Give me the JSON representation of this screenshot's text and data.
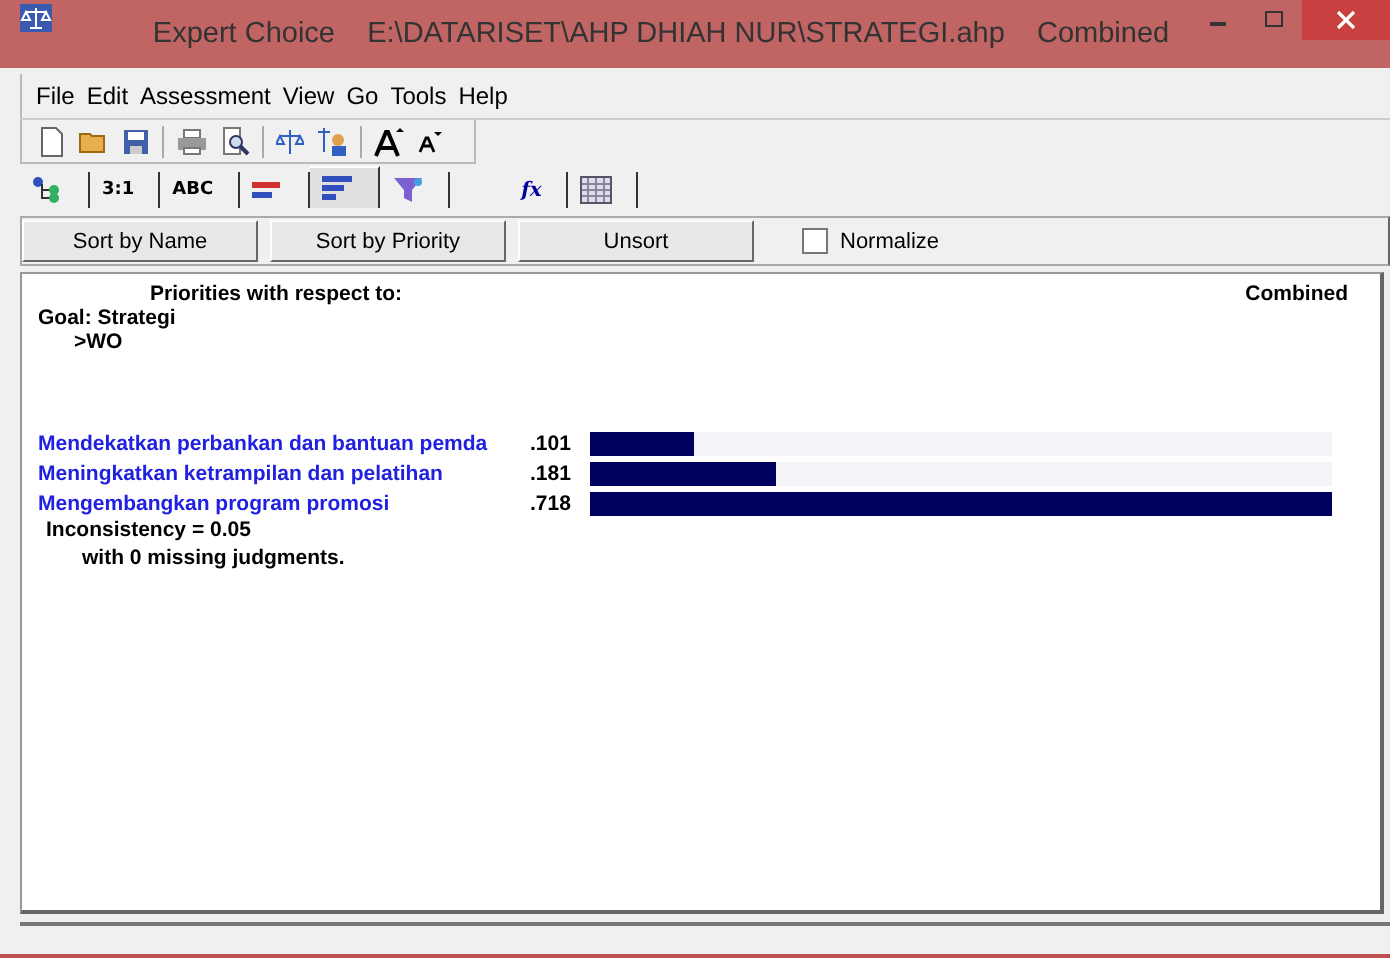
{
  "window": {
    "title": "Expert Choice    E:\\DATARISET\\AHP DHIAH NUR\\STRATEGI.ahp    Combined"
  },
  "menu": [
    "File",
    "Edit",
    "Assessment",
    "View",
    "Go",
    "Tools",
    "Help"
  ],
  "toolbar": [
    {
      "kind": "new"
    },
    {
      "kind": "open"
    },
    {
      "kind": "save"
    },
    {
      "kind": "sep"
    },
    {
      "kind": "print"
    },
    {
      "kind": "preview"
    },
    {
      "kind": "sep"
    },
    {
      "kind": "scale"
    },
    {
      "kind": "people"
    },
    {
      "kind": "sep"
    },
    {
      "kind": "font-up"
    },
    {
      "kind": "font-down"
    }
  ],
  "tabs": [
    {
      "kind": "tree",
      "selected": false
    },
    {
      "kind": "text",
      "label": "3:1",
      "selected": false
    },
    {
      "kind": "text",
      "label": "ABC",
      "selected": false
    },
    {
      "kind": "bars-red",
      "selected": false
    },
    {
      "kind": "bars-blue",
      "selected": true
    },
    {
      "kind": "funnel",
      "selected": false
    }
  ],
  "tool_tabs": [
    {
      "kind": "fx",
      "label": "fx",
      "selected": false
    },
    {
      "kind": "grid",
      "selected": false
    }
  ],
  "buttons": [
    {
      "label": "Sort by Name"
    },
    {
      "label": "Sort by Priority"
    },
    {
      "label": "Unsort"
    }
  ],
  "normalize": {
    "label": "Normalize",
    "checked": false
  },
  "report": {
    "heading": "Priorities with respect to:",
    "mode": "Combined",
    "goal": "Goal: Strategi",
    "node": ">WO",
    "rows": [
      {
        "name": "Mendekatkan perbankan dan bantuan pemda",
        "value": ".101",
        "level": 0.141
      },
      {
        "name": "Meningkatkan ketrampilan dan pelatihan",
        "value": ".181",
        "level": 0.252
      },
      {
        "name": "Mengembangkan program promosi",
        "value": ".718",
        "level": 1.0
      }
    ],
    "inconsistency": "Inconsistency = 0.05",
    "missing": "with 0  missing judgments."
  }
}
